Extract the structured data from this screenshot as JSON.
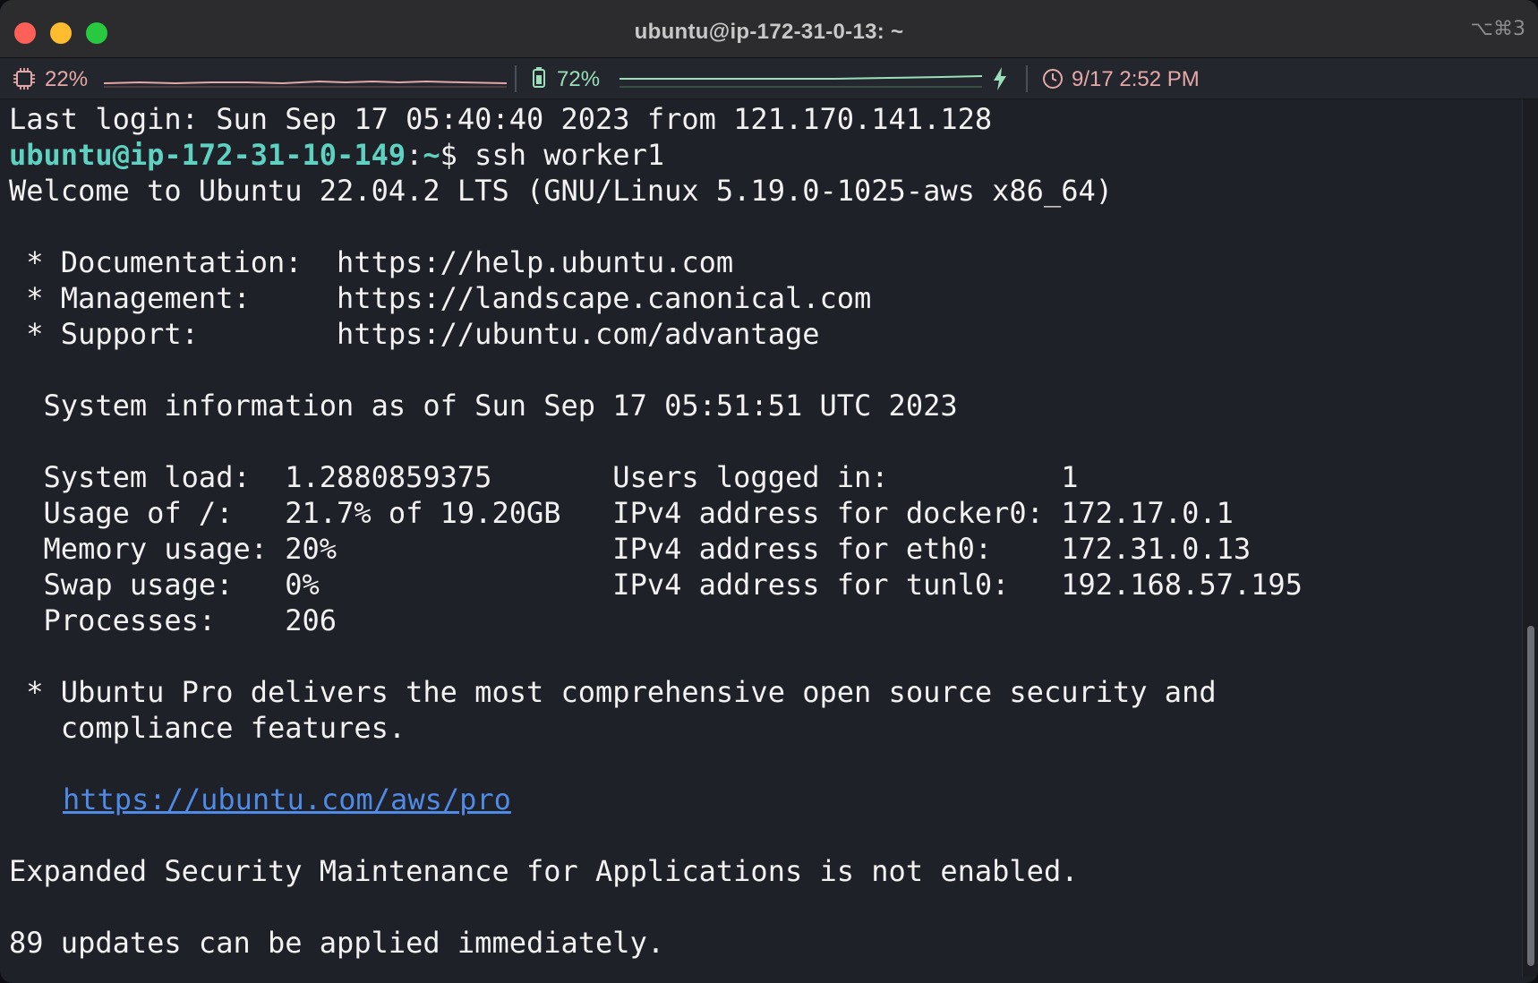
{
  "window": {
    "title": "ubuntu@ip-172-31-0-13: ~",
    "shortcut": "⌥⌘3"
  },
  "status": {
    "cpu_label": "22%",
    "cpu_percent": 22,
    "battery_label": "72%",
    "battery_percent": 72,
    "battery_charging": true,
    "clock": "9/17 2:52 PM",
    "colors": {
      "cpu": "#e5a8a8",
      "battery": "#9adfb9",
      "clock": "#e5a8a8"
    }
  },
  "terminal": {
    "last_login": "Last login: Sun Sep 17 05:40:40 2023 from 121.170.141.128",
    "prompt_user": "ubuntu@ip-172-31-10-149",
    "prompt_sep": ":",
    "prompt_path": "~",
    "prompt_command": "$ ssh worker1",
    "welcome": "Welcome to Ubuntu 22.04.2 LTS (GNU/Linux 5.19.0-1025-aws x86_64)",
    "docs": " * Documentation:  https://help.ubuntu.com",
    "management": " * Management:     https://landscape.canonical.com",
    "support": " * Support:        https://ubuntu.com/advantage",
    "sysinfo": "  System information as of Sun Sep 17 05:51:51 UTC 2023",
    "row1": "  System load:  1.2880859375       Users logged in:          1",
    "row2": "  Usage of /:   21.7% of 19.20GB   IPv4 address for docker0: 172.17.0.1",
    "row3": "  Memory usage: 20%                IPv4 address for eth0:    172.31.0.13",
    "row4": "  Swap usage:   0%                 IPv4 address for tunl0:   192.168.57.195",
    "row5": "  Processes:    206",
    "pro_line1": " * Ubuntu Pro delivers the most comprehensive open source security and",
    "pro_line2": "   compliance features.",
    "pro_link": "https://ubuntu.com/aws/pro",
    "esm": "Expanded Security Maintenance for Applications is not enabled.",
    "updates": "89 updates can be applied immediately."
  },
  "icons": {
    "cpu": "cpu-chip-icon",
    "battery": "battery-icon",
    "charging": "lightning-bolt-icon",
    "clock": "clock-icon"
  }
}
